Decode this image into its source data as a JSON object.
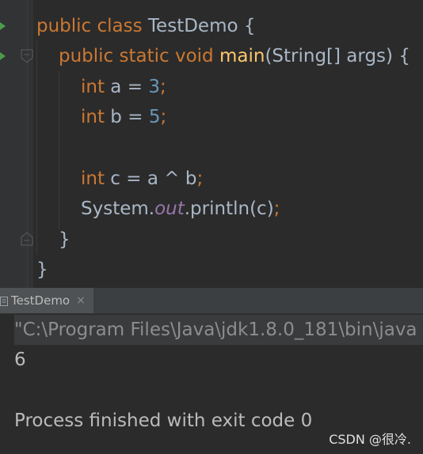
{
  "editor": {
    "line1": {
      "kw": "public class",
      "name": " TestDemo {"
    },
    "line2": {
      "kw": "public static void",
      "fn": "main",
      "rest": "(String[] args) {"
    },
    "line3": {
      "kw": "int",
      "mid": " a = ",
      "num": "3",
      "end": ";"
    },
    "line4": {
      "kw": "int",
      "mid": " b = ",
      "num": "5",
      "end": ";"
    },
    "line6": {
      "kw": "int",
      "mid": " c = a ^ b",
      "end": ";"
    },
    "line7": {
      "pre": "System.",
      "field": "out",
      "post": ".println(c)",
      "end": ";"
    },
    "line8": {
      "text": "}"
    },
    "line9": {
      "text": "}"
    }
  },
  "run_panel": {
    "tab_label": "TestDemo",
    "tab_close": "×",
    "command": "\"C:\\Program Files\\Java\\jdk1.8.0_181\\bin\\java",
    "output": "6",
    "exit_message": "Process finished with exit code 0"
  },
  "watermark": "CSDN @很冷."
}
